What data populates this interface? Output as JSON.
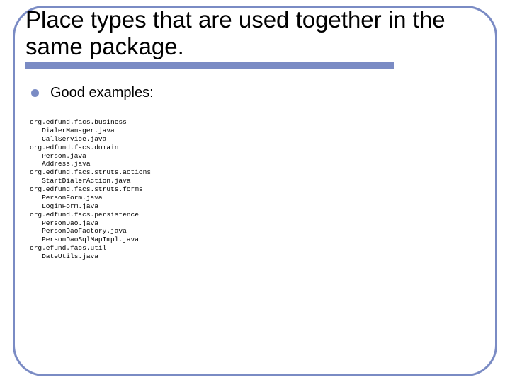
{
  "slide": {
    "title": "Place types that are used together in the same package.",
    "bullet1": "Good examples:",
    "code": "org.edfund.facs.business\n   DialerManager.java\n   CallService.java\norg.edfund.facs.domain\n   Person.java\n   Address.java\norg.edfund.facs.struts.actions\n   StartDialerAction.java\norg.edfund.facs.struts.forms\n   PersonForm.java\n   LoginForm.java\norg.edfund.facs.persistence\n   PersonDao.java\n   PersonDaoFactory.java\n   PersonDaoSqlMapImpl.java\norg.efund.facs.util\n   DateUtils.java"
  }
}
